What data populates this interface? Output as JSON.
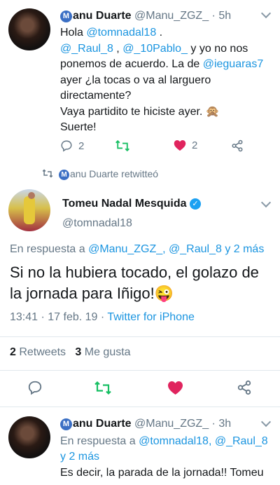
{
  "tweet1": {
    "display_name": "anu Duarte",
    "handle": "@Manu_ZGZ_",
    "time": "· 5h",
    "text_hola": "Hola",
    "mention_tomeu": "@tomnadal18",
    "text_dot": " .",
    "mention_raul": "@_Raul_8",
    "text_comma": " , ",
    "mention_pablo": "@_10Pablo_",
    "text_line2": " y yo no nos ponemos de acuerdo. La de ",
    "mention_ieguaras": "@ieguaras7",
    "text_line3": " ayer ¿la tocas o va al larguero directamente?",
    "text_line4": "Vaya partidito te hiciste ayer. 🙊",
    "text_line5": "Suerte!",
    "reply_count": "2",
    "like_count": "2"
  },
  "retweet_context": {
    "label": "anu Duarte retwitteó"
  },
  "main_tweet": {
    "display_name": "Tomeu Nadal Mesquida",
    "handle": "@tomnadal18",
    "reply_prefix": "En respuesta a ",
    "reply_mentions": "@Manu_ZGZ_, @_Raul_8 y 2 más",
    "text": "Si no la hubiera tocado, el golazo de la jornada para Iñigo!😜",
    "timestamp": "13:41 · 17 feb. 19 · ",
    "source": "Twitter for iPhone",
    "retweets_count": "2",
    "retweets_label": " Retweets",
    "likes_count": "3",
    "likes_label": " Me gusta"
  },
  "tweet3": {
    "display_name": "anu Duarte",
    "handle": "@Manu_ZGZ_",
    "time": "· 3h",
    "reply_prefix": "En respuesta a ",
    "reply_mentions_1": "@tomnadal18, @_Raul_8",
    "reply_mentions_2": "y 2 más",
    "text": "Es decir, la parada de la jornada!! Tomeu"
  },
  "colors": {
    "link": "#1b95e0",
    "retweet_green": "#17bf63",
    "like_red": "#e0245e",
    "verified_blue": "#1da1f2"
  }
}
